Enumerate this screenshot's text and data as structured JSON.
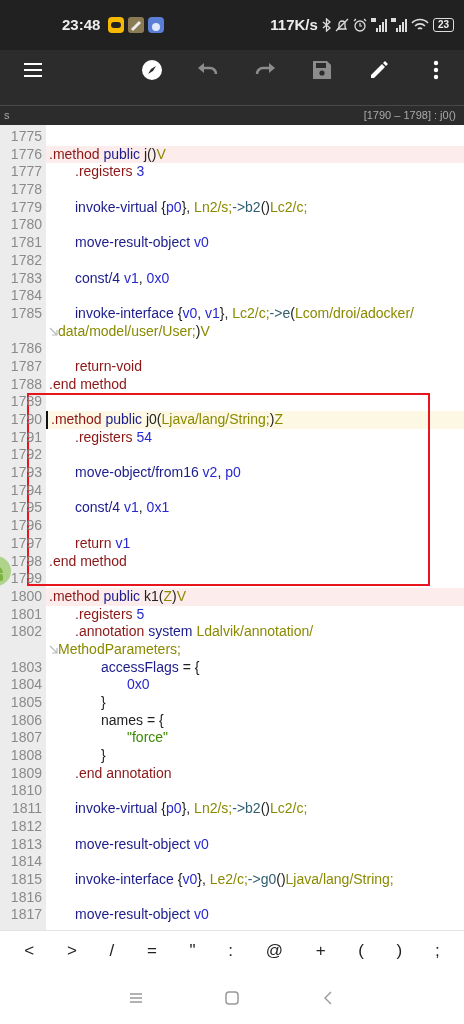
{
  "status_bar": {
    "time": "23:48",
    "speed": "117K/s",
    "battery": "23"
  },
  "toolbar": [
    {
      "kind": "menu",
      "disabled": false
    },
    {
      "kind": "navigate",
      "disabled": false
    },
    {
      "kind": "undo",
      "disabled": true
    },
    {
      "kind": "redo",
      "disabled": true
    },
    {
      "kind": "save",
      "disabled": true
    },
    {
      "kind": "edit",
      "disabled": false
    },
    {
      "kind": "more",
      "disabled": false
    }
  ],
  "info_bar": {
    "file": "s",
    "range": "[1790 – 1798] : j0()"
  },
  "editor": {
    "lines": [
      {
        "number": "1775"
      },
      {
        "number": "1776",
        "marked": true,
        "tokens": [
          {
            "kind": "directive",
            "text": ".method"
          },
          {
            "kind": "keyword",
            "text": " public"
          },
          {
            "kind": "plain",
            "text": " j()"
          },
          {
            "kind": "type",
            "text": "V"
          }
        ],
        "children": [
          {
            "number": "1777",
            "tokens": [
              {
                "kind": "directive",
                "text": ".registers"
              },
              {
                "kind": "register",
                "text": " 3"
              }
            ]
          },
          {
            "number": "1778"
          },
          {
            "number": "1779",
            "tokens": [
              {
                "kind": "keyword",
                "text": "invoke-virtual"
              },
              {
                "kind": "plain",
                "text": " {"
              },
              {
                "kind": "register",
                "text": "p0"
              },
              {
                "kind": "plain",
                "text": "}, "
              },
              {
                "kind": "type",
                "text": "Ln2/s;"
              },
              {
                "kind": "member",
                "text": "->b2"
              },
              {
                "kind": "plain",
                "text": "()"
              },
              {
                "kind": "type",
                "text": "Lc2/c;"
              }
            ]
          },
          {
            "number": "1780"
          },
          {
            "number": "1781",
            "tokens": [
              {
                "kind": "keyword",
                "text": "move-result-object"
              },
              {
                "kind": "register",
                "text": " v0"
              }
            ]
          },
          {
            "number": "1782"
          },
          {
            "number": "1783",
            "tokens": [
              {
                "kind": "keyword",
                "text": "const/4"
              },
              {
                "kind": "register",
                "text": " v1"
              },
              {
                "kind": "plain",
                "text": ", "
              },
              {
                "kind": "register",
                "text": "0x0"
              }
            ]
          },
          {
            "number": "1784"
          },
          {
            "number": "1785",
            "tokens": [
              {
                "kind": "keyword",
                "text": "invoke-interface"
              },
              {
                "kind": "plain",
                "text": " {"
              },
              {
                "kind": "register",
                "text": "v0"
              },
              {
                "kind": "plain",
                "text": ", "
              },
              {
                "kind": "register",
                "text": "v1"
              },
              {
                "kind": "plain",
                "text": "}, "
              },
              {
                "kind": "type",
                "text": "Lc2/c;"
              },
              {
                "kind": "member",
                "text": "->e"
              },
              {
                "kind": "plain",
                "text": "("
              },
              {
                "kind": "type",
                "text": "Lcom/droi/adocker/"
              }
            ],
            "continuation": [
              {
                "kind": "type",
                "text": "data/model/user/User;"
              },
              {
                "kind": "plain",
                "text": ")"
              },
              {
                "kind": "type",
                "text": "V"
              }
            ]
          },
          {
            "number": "1786"
          },
          {
            "number": "1787",
            "tokens": [
              {
                "kind": "directive",
                "text": "return-void"
              }
            ]
          }
        ]
      },
      {
        "number": "1788",
        "tokens": [
          {
            "kind": "directive",
            "text": ".end method"
          }
        ]
      },
      {
        "number": "1789"
      },
      {
        "number": "1790",
        "cursor": true,
        "tokens": [
          {
            "kind": "directive",
            "text": ".method"
          },
          {
            "kind": "keyword",
            "text": " public"
          },
          {
            "kind": "plain",
            "text": " j0("
          },
          {
            "kind": "type",
            "text": "Ljava/lang/String;"
          },
          {
            "kind": "plain",
            "text": ")"
          },
          {
            "kind": "type",
            "text": "Z"
          }
        ],
        "children": [
          {
            "number": "1791",
            "tokens": [
              {
                "kind": "directive",
                "text": ".registers"
              },
              {
                "kind": "register",
                "text": " 54"
              }
            ]
          },
          {
            "number": "1792"
          },
          {
            "number": "1793",
            "tokens": [
              {
                "kind": "keyword",
                "text": "move-object/from16"
              },
              {
                "kind": "register",
                "text": " v2"
              },
              {
                "kind": "plain",
                "text": ", "
              },
              {
                "kind": "register",
                "text": "p0"
              }
            ]
          },
          {
            "number": "1794"
          },
          {
            "number": "1795",
            "tokens": [
              {
                "kind": "keyword",
                "text": "const/4"
              },
              {
                "kind": "register",
                "text": " v1"
              },
              {
                "kind": "plain",
                "text": ", "
              },
              {
                "kind": "register",
                "text": "0x1"
              }
            ]
          },
          {
            "number": "1796"
          },
          {
            "number": "1797",
            "tokens": [
              {
                "kind": "directive",
                "text": "return"
              },
              {
                "kind": "register",
                "text": " v1"
              }
            ]
          }
        ]
      },
      {
        "number": "1798",
        "tokens": [
          {
            "kind": "directive",
            "text": ".end method"
          }
        ]
      },
      {
        "number": "1799"
      },
      {
        "number": "1800",
        "marked": true,
        "tokens": [
          {
            "kind": "directive",
            "text": ".method"
          },
          {
            "kind": "keyword",
            "text": " public"
          },
          {
            "kind": "plain",
            "text": " k1("
          },
          {
            "kind": "type",
            "text": "Z"
          },
          {
            "kind": "plain",
            "text": ")"
          },
          {
            "kind": "type",
            "text": "V"
          }
        ],
        "children": [
          {
            "number": "1801",
            "tokens": [
              {
                "kind": "directive",
                "text": ".registers"
              },
              {
                "kind": "register",
                "text": " 5"
              }
            ]
          },
          {
            "number": "1802",
            "tokens": [
              {
                "kind": "directive",
                "text": ".annotation"
              },
              {
                "kind": "keyword",
                "text": " system"
              },
              {
                "kind": "type",
                "text": " Ldalvik/annotation/"
              }
            ],
            "continuation": [
              {
                "kind": "type",
                "text": "MethodParameters;"
              }
            ],
            "children": [
              {
                "number": "1803",
                "tokens": [
                  {
                    "kind": "keyword",
                    "text": "accessFlags"
                  },
                  {
                    "kind": "plain",
                    "text": " = {"
                  }
                ],
                "children": [
                  {
                    "number": "1804",
                    "tokens": [
                      {
                        "kind": "register",
                        "text": "0x0"
                      }
                    ]
                  }
                ]
              },
              {
                "number": "1805",
                "tokens": [
                  {
                    "kind": "plain",
                    "text": "}"
                  }
                ]
              },
              {
                "number": "1806",
                "tokens": [
                  {
                    "kind": "plain",
                    "text": "names = {"
                  }
                ],
                "children": [
                  {
                    "number": "1807",
                    "tokens": [
                      {
                        "kind": "string",
                        "text": "\"force\""
                      }
                    ]
                  }
                ]
              },
              {
                "number": "1808",
                "tokens": [
                  {
                    "kind": "plain",
                    "text": "}"
                  }
                ]
              }
            ]
          },
          {
            "number": "1809",
            "tokens": [
              {
                "kind": "directive",
                "text": ".end annotation"
              }
            ]
          },
          {
            "number": "1810"
          },
          {
            "number": "1811",
            "tokens": [
              {
                "kind": "keyword",
                "text": "invoke-virtual"
              },
              {
                "kind": "plain",
                "text": " {"
              },
              {
                "kind": "register",
                "text": "p0"
              },
              {
                "kind": "plain",
                "text": "}, "
              },
              {
                "kind": "type",
                "text": "Ln2/s;"
              },
              {
                "kind": "member",
                "text": "->b2"
              },
              {
                "kind": "plain",
                "text": "()"
              },
              {
                "kind": "type",
                "text": "Lc2/c;"
              }
            ]
          },
          {
            "number": "1812"
          },
          {
            "number": "1813",
            "tokens": [
              {
                "kind": "keyword",
                "text": "move-result-object"
              },
              {
                "kind": "register",
                "text": " v0"
              }
            ]
          },
          {
            "number": "1814"
          },
          {
            "number": "1815",
            "tokens": [
              {
                "kind": "keyword",
                "text": "invoke-interface"
              },
              {
                "kind": "plain",
                "text": " {"
              },
              {
                "kind": "register",
                "text": "v0"
              },
              {
                "kind": "plain",
                "text": "}, "
              },
              {
                "kind": "type",
                "text": "Le2/c;"
              },
              {
                "kind": "member",
                "text": "->g0"
              },
              {
                "kind": "plain",
                "text": "()"
              },
              {
                "kind": "type",
                "text": "Ljava/lang/String;"
              }
            ]
          },
          {
            "number": "1816"
          },
          {
            "number": "1817",
            "tokens": [
              {
                "kind": "keyword",
                "text": "move-result-object"
              },
              {
                "kind": "register",
                "text": " v0"
              }
            ]
          }
        ]
      }
    ]
  },
  "keys": [
    "<",
    ">",
    "/",
    "=",
    "\"",
    ":",
    "@",
    "+",
    "(",
    ")",
    ";"
  ],
  "nav_bar": [
    {
      "kind": "recents"
    },
    {
      "kind": "home"
    },
    {
      "kind": "back"
    }
  ]
}
